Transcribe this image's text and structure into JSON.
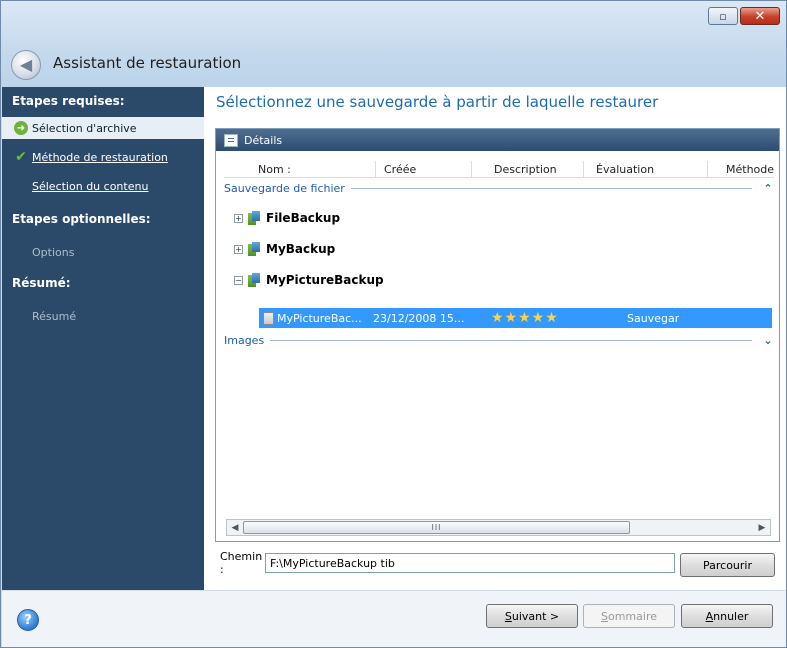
{
  "window": {
    "title": "Assistant de restauration",
    "minimize_glyph": "▫",
    "close_glyph": "✕",
    "back_glyph": "◀"
  },
  "sidebar": {
    "heading_required": "Etapes requises:",
    "heading_optional": "Etapes optionnelles:",
    "heading_summary": "Résumé:",
    "items": [
      {
        "label": "Sélection d'archive",
        "state": "active"
      },
      {
        "label": "Méthode de restauration",
        "state": "done"
      },
      {
        "label": "Sélection du contenu",
        "state": "link"
      },
      {
        "label": "Options",
        "state": "muted"
      },
      {
        "label": "Résumé",
        "state": "muted"
      }
    ],
    "active_icon_glyph": "➜",
    "done_icon_glyph": "✔"
  },
  "main": {
    "title": "Sélectionnez une sauvegarde à partir de laquelle restaurer"
  },
  "panel": {
    "header": "Détails",
    "columns": [
      "Nom :",
      "Créée",
      "Description",
      "Évaluation",
      "Méthode"
    ],
    "groups": [
      {
        "label": "Sauvegarde de fichier",
        "chevron": "⌃"
      },
      {
        "label": "Images",
        "chevron": "⌄"
      }
    ],
    "tree": [
      {
        "name": "FileBackup",
        "expander": "+"
      },
      {
        "name": "MyBackup",
        "expander": "+"
      },
      {
        "name": "MyPictureBackup",
        "expander": "−"
      }
    ],
    "selected_row": {
      "name": "MyPictureBac...",
      "created": "23/12/2008 15...",
      "rating": "★★★★★",
      "rating_value": 5,
      "method": "Sauvegarde"
    },
    "scroll_left_glyph": "◀",
    "scroll_right_glyph": "▶",
    "scroll_grip": "III"
  },
  "path": {
    "label": "Chemin :",
    "value": "F:\\MyPictureBackup tib",
    "browse_label": "Parcourir"
  },
  "footer": {
    "help_glyph": "?",
    "next": {
      "mnemonic": "S",
      "rest": "uivant >"
    },
    "summary": {
      "mnemonic": "S",
      "rest": "ommaire"
    },
    "cancel": {
      "mnemonic": "A",
      "rest": "nnuler"
    }
  },
  "colors": {
    "sidebar_bg": "#2b4a6a",
    "title_blue": "#1d6bb2",
    "selection": "#3399ff",
    "header_bar": "#2c4d70"
  }
}
